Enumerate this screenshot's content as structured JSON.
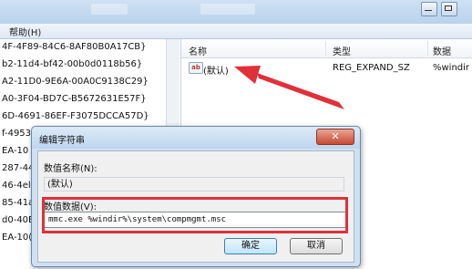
{
  "menubar": {
    "help": "帮助(H)"
  },
  "tree": {
    "items": [
      "4F-4F89-84C6-8AF80B0A17CB}",
      "b2-11d4-bf42-00b0d0118b56}",
      "A2-11D0-9E6A-00A0C9138C29}",
      "A0-3F04-BD7C-B5672631E57F}",
      "6D-4691-86EF-F3075DCCA57D}",
      "f-4953",
      "EA-10",
      "287-44",
      "46-4el",
      "85-41a",
      "d0-40E",
      "EA-10("
    ]
  },
  "list": {
    "columns": {
      "name": "名称",
      "type": "类型",
      "data": "数据"
    },
    "row": {
      "icon": "ab",
      "name": "(默认)",
      "type": "REG_EXPAND_SZ",
      "data": "%windir"
    }
  },
  "dialog": {
    "title": "编辑字符串",
    "close": "✕",
    "value_name_label": "数值名称(N):",
    "value_name": "(默认)",
    "value_data_label": "数值数据(V):",
    "value_data": "mmc.exe %windir%\\system\\compmgmt.msc",
    "ok": "确定",
    "cancel": "取消"
  },
  "colors": {
    "annotation": "#e0303a",
    "dialog_frame": "#cfe0f2"
  }
}
